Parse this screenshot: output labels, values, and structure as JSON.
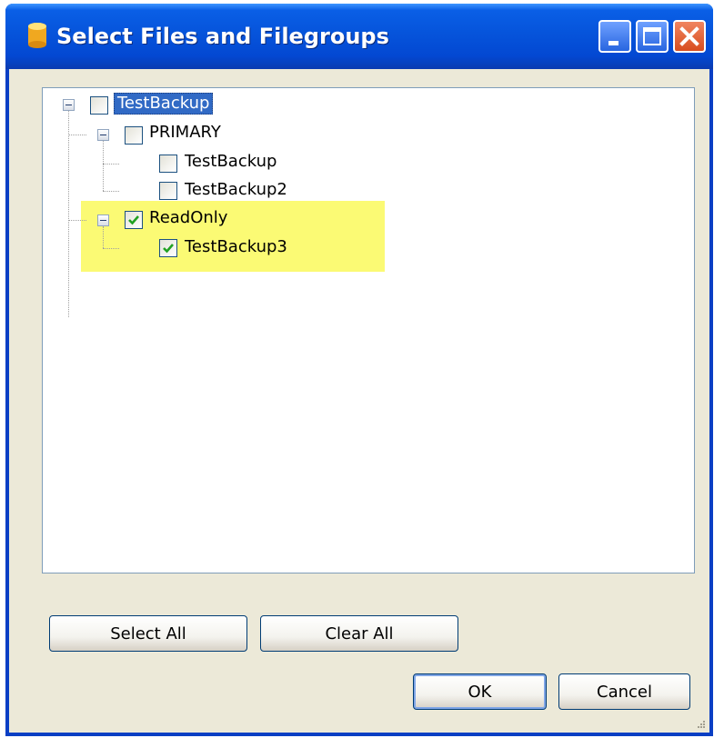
{
  "window": {
    "title": "Select Files and Filegroups",
    "title_color": "#0654db"
  },
  "tree": {
    "highlight_color": "#fbfa74",
    "nodes": [
      {
        "label": "TestBackup",
        "checked": false,
        "selected": true
      },
      {
        "label": "PRIMARY",
        "checked": false
      },
      {
        "label": "TestBackup",
        "checked": false
      },
      {
        "label": "TestBackup2",
        "checked": false
      },
      {
        "label": "ReadOnly",
        "checked": true
      },
      {
        "label": "TestBackup3",
        "checked": true
      }
    ]
  },
  "buttons": {
    "select_all": "Select All",
    "clear_all": "Clear All",
    "ok": "OK",
    "cancel": "Cancel"
  }
}
